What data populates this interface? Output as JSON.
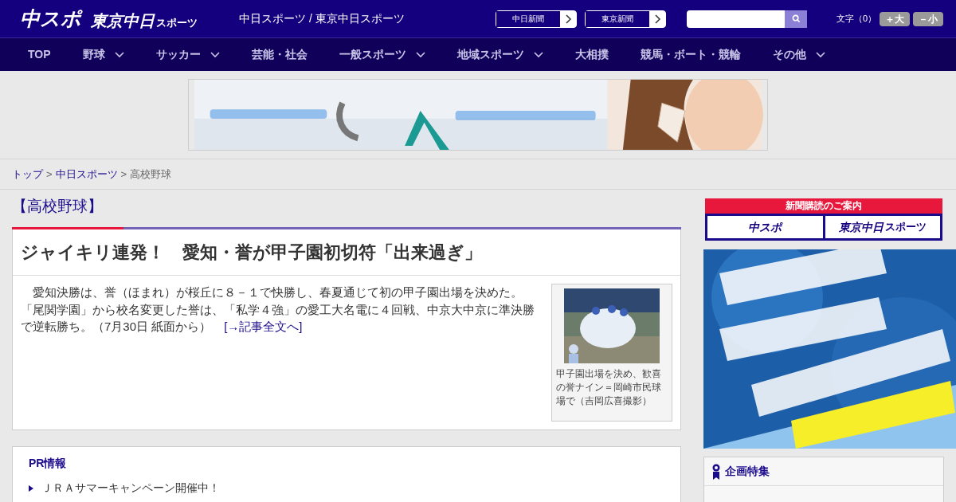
{
  "header": {
    "logo_main": "中スポ",
    "logo_sub": "東京中日",
    "logo_sub_small": "スポーツ",
    "site_title": "中日スポーツ / 東京中日スポーツ",
    "link_buttons": [
      "中日新聞",
      "東京新聞"
    ],
    "font_size": {
      "label": "文字（0）",
      "buttons": [
        "＋大",
        "－小"
      ]
    }
  },
  "nav": [
    {
      "label": "TOP",
      "dropdown": false
    },
    {
      "label": "野球",
      "dropdown": true
    },
    {
      "label": "サッカー",
      "dropdown": true
    },
    {
      "label": "芸能・社会",
      "dropdown": false
    },
    {
      "label": "一般スポーツ",
      "dropdown": true
    },
    {
      "label": "地域スポーツ",
      "dropdown": true
    },
    {
      "label": "大相撲",
      "dropdown": false
    },
    {
      "label": "競馬・ボート・競輪",
      "dropdown": false
    },
    {
      "label": "その他",
      "dropdown": true
    }
  ],
  "breadcrumb_separator": ">",
  "breadcrumb": [
    {
      "label": "トップ",
      "link": true
    },
    {
      "label": "中日スポーツ",
      "link": true
    },
    {
      "label": "高校野球",
      "link": false
    }
  ],
  "section_title": "【高校野球】",
  "article": {
    "headline": "ジャイキリ連発！　愛知・誉が甲子園初切符「出来過ぎ」",
    "body": "　愛知決勝は、誉（ほまれ）が桜丘に８－１で快勝し、春夏通じて初の甲子園出場を決めた。「尾関学園」から校名変更した誉は、「私学４強」の愛工大名電に４回戦、中京大中京に準決勝で逆転勝ち。（7月30日 紙面から）",
    "more_link": "[→記事全文へ]",
    "photo": {
      "kind": "picture",
      "caption": "甲子園出場を決め、歓喜の誉ナイン＝岡崎市民球場で（吉岡広喜撮影）"
    }
  },
  "pr": {
    "title": "PR情報",
    "items": [
      "ＪＲＡサマーキャンペーン開催中！"
    ]
  },
  "sidebar": {
    "subscribe": {
      "title": "新聞購読のご案内",
      "logos": [
        "中スポ",
        "東京中日"
      ],
      "logo_small": "スポーツ"
    },
    "feature": {
      "title": "企画特集"
    }
  }
}
